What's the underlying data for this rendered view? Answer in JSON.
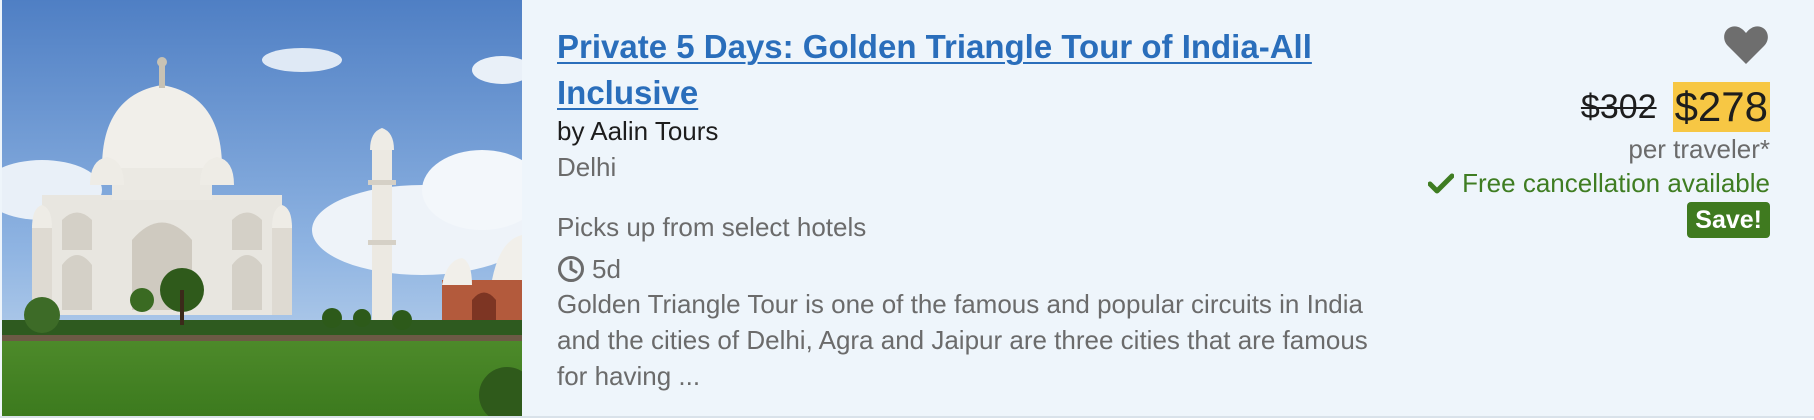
{
  "listing": {
    "title": "Private 5 Days: Golden Triangle Tour of India-All Inclusive",
    "operator": "by Aalin Tours",
    "location": "Delhi",
    "pickup": "Picks up from select hotels",
    "duration": "5d",
    "description": "Golden Triangle Tour is one of the famous and popular circuits in India and the cities of Delhi, Agra and Jaipur are three cities that are famous for having ...",
    "image_icon": "taj-mahal-photo"
  },
  "pricing": {
    "old_price": "$302",
    "new_price": "$278",
    "per_traveler": "per traveler*",
    "free_cancellation": "Free cancellation available",
    "save_label": "Save!"
  },
  "icons": {
    "favorite": "heart-icon",
    "duration": "clock-icon",
    "cancellation": "check-icon"
  },
  "colors": {
    "link": "#2a6ebb",
    "card_bg": "#eef5fb",
    "price_highlight": "#f7c744",
    "success": "#3f7d22",
    "save_badge": "#3f7a1f",
    "heart": "#6e6e6e"
  }
}
